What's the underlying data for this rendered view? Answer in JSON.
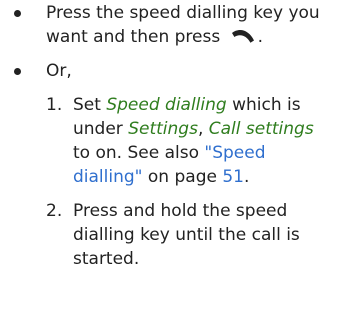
{
  "bullets": [
    {
      "marker": "•",
      "line1": "Press the speed dialling key you",
      "line2_before": "want and then press ",
      "line2_after": ".",
      "icon": "call-key-icon"
    },
    {
      "marker": "•",
      "text": "Or,"
    }
  ],
  "steps": [
    {
      "number": "1.",
      "line1_before": "Set ",
      "line1_link": "Speed dialling",
      "line1_after": " which is",
      "line2_before": "under ",
      "line2_link1": "Settings",
      "line2_sep": ", ",
      "line2_link2": "Call settings",
      "line3_before": "to on. See also ",
      "line3_ref": "\"Speed",
      "line4_ref": "dialling\"",
      "line4_mid": " on page ",
      "line4_page": "51",
      "line4_end": "."
    },
    {
      "number": "2.",
      "line1": "Press and hold the speed",
      "line2": "dialling key until the call is",
      "line3": "started."
    }
  ],
  "colors": {
    "text": "#222222",
    "menu_term": "#2f7d1e",
    "cross_reference": "#2f6fce"
  }
}
